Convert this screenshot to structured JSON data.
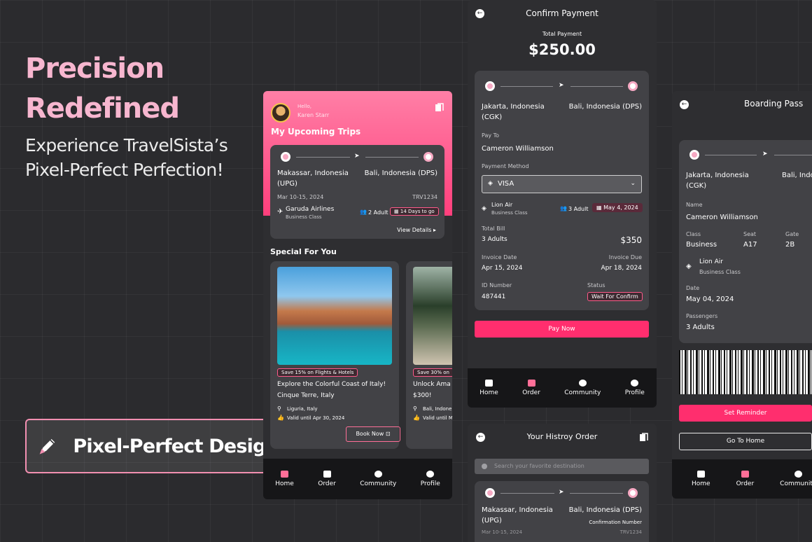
{
  "hero": {
    "title_line1": "Precision",
    "title_line2": "Redefined",
    "subtitle_line1": "Experience TravelSista’s",
    "subtitle_line2": "Pixel-Perfect Perfection!",
    "badge": "Pixel-Perfect Design"
  },
  "colors": {
    "accent": "#ff2e6e",
    "pink_soft": "#f7b6cf",
    "background": "#2b2b2e",
    "panel": "#424246"
  },
  "home": {
    "greeting": "Hello,",
    "user": "Karen Starr",
    "upcoming_title": "My Upcoming Trips",
    "trip": {
      "from": "Makassar, Indonesia",
      "from_code": "(UPG)",
      "to": "Bali, Indonesia (DPS)",
      "date": "Mar 10-15, 2024",
      "code": "TRV1234",
      "airline": "Garuda Airlines",
      "class": "Business Class",
      "pax": "2 Adult",
      "countdown": "14 Days to go",
      "details": "View Details"
    },
    "special_title": "Special For You",
    "offers": [
      {
        "promo": "Save 15% on Flights & Hotels",
        "title1": "Explore the Colorful Coast of Italy!",
        "title2": "Cinque Terre, Italy",
        "location": "Liguria, Italy",
        "valid": "Valid until Apr 30, 2024",
        "cta": "Book Now"
      },
      {
        "promo": "Save 30% on",
        "title1": "Unlock Ama",
        "title2": "$300!",
        "location": "Bali, Indone",
        "valid": "Valid until M"
      }
    ],
    "nav": [
      "Home",
      "Order",
      "Community",
      "Profile"
    ]
  },
  "payment": {
    "title": "Confirm Payment",
    "total_label": "Total Payment",
    "total": "$250.00",
    "from": "Jakarta, Indonesia",
    "from_code": "(CGK)",
    "to": "Bali, Indonesia (DPS)",
    "pay_to_label": "Pay To",
    "pay_to": "Cameron Williamson",
    "method_label": "Payment Method",
    "method": "VISA",
    "airline": "Lion Air",
    "class": "Business Class",
    "pax": "3 Adult",
    "date": "May 4, 2024",
    "bill_label": "Total Bill",
    "bill_desc": "3 Adults",
    "bill": "$350",
    "invoice_date_label": "Invoice Date",
    "invoice_date": "Apr 15, 2024",
    "invoice_due_label": "Invoice Due",
    "invoice_due": "Apr 18, 2024",
    "id_label": "ID Number",
    "id": "487441",
    "status_label": "Status",
    "status": "Wait For Confirm",
    "cta": "Pay Now",
    "nav": [
      "Home",
      "Order",
      "Community",
      "Profile"
    ]
  },
  "history": {
    "title": "Your Histroy Order",
    "search_placeholder": "Search your favorite destination",
    "from": "Makassar, Indonesia",
    "from_code": "(UPG)",
    "to": "Bali, Indonesia (DPS)",
    "confirm_label": "Confirmation Number",
    "date": "Mar 10-15, 2024",
    "code": "TRV1234"
  },
  "boarding": {
    "title": "Boarding Pass",
    "from": "Jakarta, Indonesia",
    "from_code": "(CGK)",
    "to": "Bali, Indon",
    "name_label": "Name",
    "name": "Cameron Williamson",
    "class_label": "Class",
    "class": "Business",
    "seat_label": "Seat",
    "seat": "A17",
    "gate_label": "Gate",
    "gate": "2B",
    "airline": "Lion Air",
    "airline_class": "Business Class",
    "date_label": "Date",
    "date": "May 04, 2024",
    "passengers_label": "Passengers",
    "passengers": "3 Adults",
    "reminder": "Set Reminder",
    "home": "Go To Home",
    "nav": [
      "Home",
      "Order",
      "Community"
    ]
  }
}
